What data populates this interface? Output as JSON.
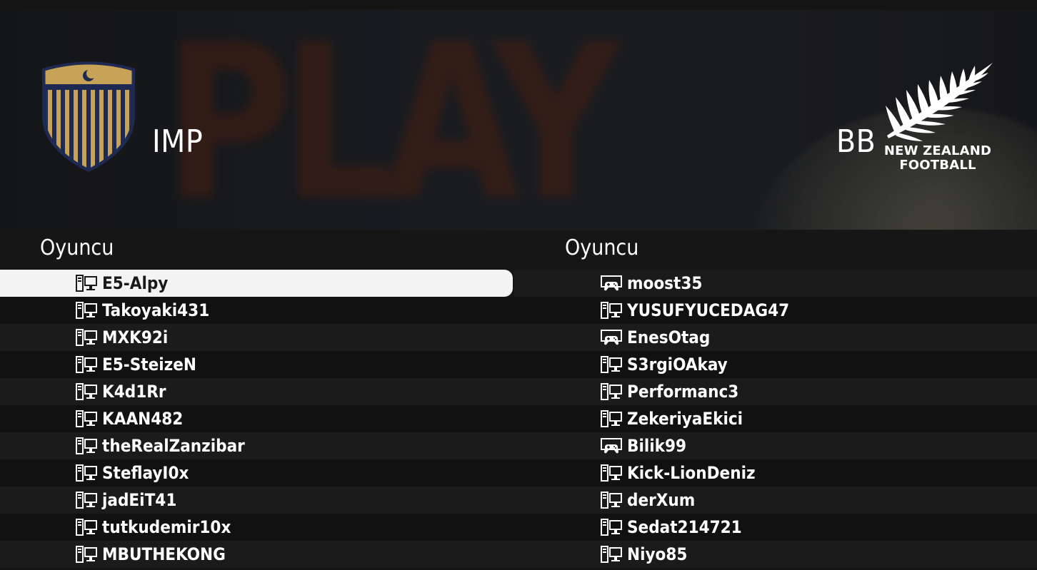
{
  "teams": {
    "home": {
      "name": "IMP",
      "crest_colors": {
        "gold": "#c8a257",
        "navy": "#1e2a52"
      }
    },
    "away": {
      "name": "BB",
      "logo_text_line1": "NEW ZEALAND",
      "logo_text_line2": "FOOTBALL"
    }
  },
  "background_text": "PLAY",
  "left_list": {
    "title": "Oyuncu",
    "selected_index": 0,
    "players": [
      {
        "name": "E5-Alpy",
        "platform": "pc-icon"
      },
      {
        "name": "Takoyaki431",
        "platform": "pc-icon"
      },
      {
        "name": "MXK92i",
        "platform": "pc-icon"
      },
      {
        "name": "E5-SteizeN",
        "platform": "pc-icon"
      },
      {
        "name": "K4d1Rr",
        "platform": "pc-icon"
      },
      {
        "name": "KAAN482",
        "platform": "pc-icon"
      },
      {
        "name": "theRealZanzibar",
        "platform": "pc-icon"
      },
      {
        "name": "SteflayI0x",
        "platform": "pc-icon"
      },
      {
        "name": "jadEiT41",
        "platform": "pc-icon"
      },
      {
        "name": "tutkudemir10x",
        "platform": "pc-icon"
      },
      {
        "name": "MBUTHEKONG",
        "platform": "pc-icon"
      }
    ]
  },
  "right_list": {
    "title": "Oyuncu",
    "players": [
      {
        "name": "moost35",
        "platform": "console-icon"
      },
      {
        "name": "YUSUFYUCEDAG47",
        "platform": "pc-icon"
      },
      {
        "name": "EnesOtag",
        "platform": "console-icon"
      },
      {
        "name": "S3rgiOAkay",
        "platform": "pc-icon"
      },
      {
        "name": "Performanc3",
        "platform": "pc-icon"
      },
      {
        "name": "ZekeriyaEkici",
        "platform": "pc-icon"
      },
      {
        "name": "Bilik99",
        "platform": "console-icon"
      },
      {
        "name": "Kick-LionDeniz",
        "platform": "pc-icon"
      },
      {
        "name": "derXum",
        "platform": "pc-icon"
      },
      {
        "name": "Sedat214721",
        "platform": "pc-icon"
      },
      {
        "name": "Niyo85",
        "platform": "pc-icon"
      }
    ]
  },
  "colors": {
    "selected_row_bg": "#f4f4f4",
    "row_odd": "#1b1b1b",
    "row_even": "#111111"
  }
}
